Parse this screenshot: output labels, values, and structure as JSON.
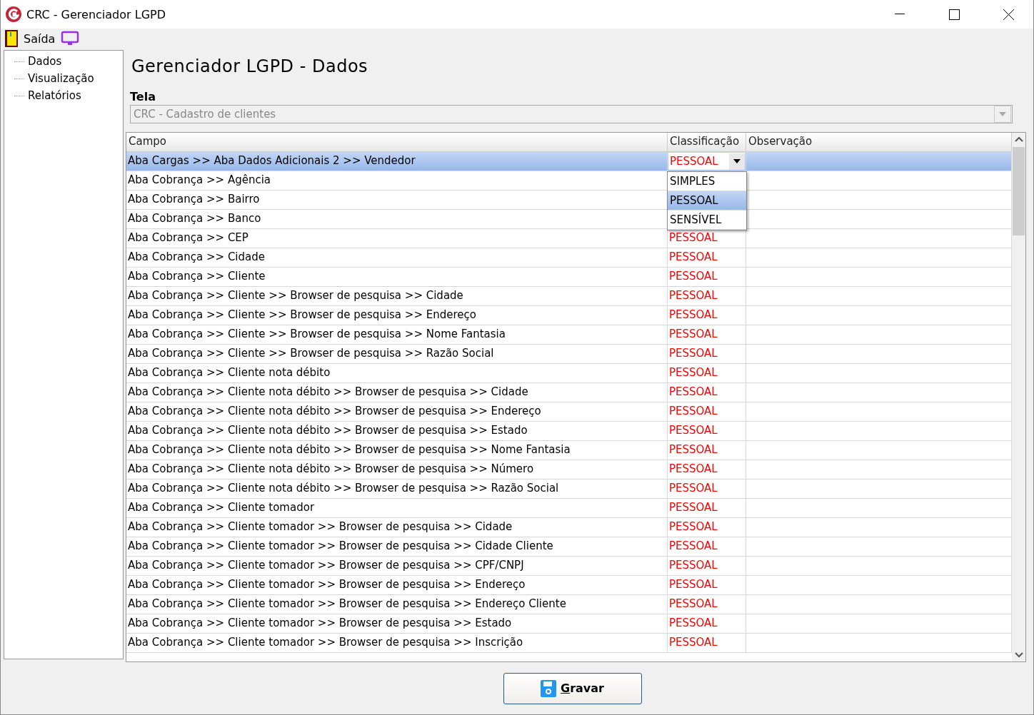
{
  "window": {
    "title": "CRC - Gerenciador LGPD"
  },
  "menu": [
    {
      "label": "Saída"
    }
  ],
  "sidebar": {
    "items": [
      {
        "label": "Dados",
        "selected": false
      },
      {
        "label": "Visualização",
        "selected": false
      },
      {
        "label": "Relatórios",
        "selected": false
      }
    ]
  },
  "heading": "Gerenciador LGPD - Dados",
  "tela": {
    "label": "Tela",
    "value": "CRC - Cadastro de clientes"
  },
  "table": {
    "columns": [
      "Campo",
      "Classificação",
      "Observação"
    ],
    "rows": [
      {
        "campo": "Aba Cargas >> Aba Dados Adicionais 2 >> Vendedor",
        "classificacao": "PESSOAL",
        "selected": true
      },
      {
        "campo": "Aba Cobrança >> Agência",
        "selected": false
      },
      {
        "campo": "Aba Cobrança >> Bairro",
        "selected": false
      },
      {
        "campo": "Aba Cobrança >> Banco",
        "selected": false
      },
      {
        "campo": "Aba Cobrança >> CEP",
        "classificacao": "PESSOAL",
        "selected": false
      },
      {
        "campo": "Aba Cobrança >> Cidade",
        "classificacao": "PESSOAL",
        "selected": false
      },
      {
        "campo": "Aba Cobrança >> Cliente",
        "classificacao": "PESSOAL",
        "selected": false
      },
      {
        "campo": "Aba Cobrança >> Cliente >> Browser de pesquisa >> Cidade",
        "classificacao": "PESSOAL",
        "selected": false
      },
      {
        "campo": "Aba Cobrança >> Cliente >> Browser de pesquisa >> Endereço",
        "classificacao": "PESSOAL",
        "selected": false
      },
      {
        "campo": "Aba Cobrança >> Cliente >> Browser de pesquisa >> Nome Fantasia",
        "classificacao": "PESSOAL",
        "selected": false
      },
      {
        "campo": "Aba Cobrança >> Cliente >> Browser de pesquisa >> Razão Social",
        "classificacao": "PESSOAL",
        "selected": false
      },
      {
        "campo": "Aba Cobrança >> Cliente nota débito",
        "classificacao": "PESSOAL",
        "selected": false
      },
      {
        "campo": "Aba Cobrança >> Cliente nota débito >> Browser de pesquisa >> Cidade",
        "classificacao": "PESSOAL",
        "selected": false
      },
      {
        "campo": "Aba Cobrança >> Cliente nota débito >> Browser de pesquisa >> Endereço",
        "classificacao": "PESSOAL",
        "selected": false
      },
      {
        "campo": "Aba Cobrança >> Cliente nota débito >> Browser de pesquisa >> Estado",
        "classificacao": "PESSOAL",
        "selected": false
      },
      {
        "campo": "Aba Cobrança >> Cliente nota débito >> Browser de pesquisa >> Nome Fantasia",
        "classificacao": "PESSOAL",
        "selected": false
      },
      {
        "campo": "Aba Cobrança >> Cliente nota débito >> Browser de pesquisa >> Número",
        "classificacao": "PESSOAL",
        "selected": false
      },
      {
        "campo": "Aba Cobrança >> Cliente nota débito >> Browser de pesquisa >> Razão Social",
        "classificacao": "PESSOAL",
        "selected": false
      },
      {
        "campo": "Aba Cobrança >> Cliente tomador",
        "classificacao": "PESSOAL",
        "selected": false
      },
      {
        "campo": "Aba Cobrança >> Cliente tomador >> Browser de pesquisa >> Cidade",
        "classificacao": "PESSOAL",
        "selected": false
      },
      {
        "campo": "Aba Cobrança >> Cliente tomador >> Browser de pesquisa >> Cidade Cliente",
        "classificacao": "PESSOAL",
        "selected": false
      },
      {
        "campo": "Aba Cobrança >> Cliente tomador >> Browser de pesquisa >> CPF/CNPJ",
        "classificacao": "PESSOAL",
        "selected": false
      },
      {
        "campo": "Aba Cobrança >> Cliente tomador >> Browser de pesquisa >> Endereço",
        "classificacao": "PESSOAL",
        "selected": false
      },
      {
        "campo": "Aba Cobrança >> Cliente tomador >> Browser de pesquisa >> Endereço Cliente",
        "classificacao": "PESSOAL",
        "selected": false
      },
      {
        "campo": "Aba Cobrança >> Cliente tomador >> Browser de pesquisa >> Estado",
        "classificacao": "PESSOAL",
        "selected": false
      },
      {
        "campo": "Aba Cobrança >> Cliente tomador >> Browser de pesquisa >> Inscrição",
        "classificacao": "PESSOAL",
        "selected": false
      }
    ]
  },
  "dropdown": {
    "options": [
      {
        "label": "SIMPLES",
        "selected": false
      },
      {
        "label": "PESSOAL",
        "selected": true
      },
      {
        "label": "SENSÍVEL",
        "selected": false
      }
    ]
  },
  "save_button": "Gravar"
}
